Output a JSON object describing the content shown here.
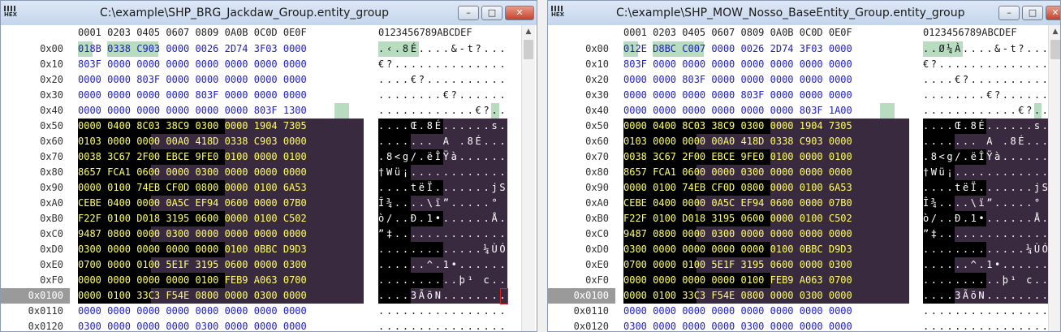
{
  "colors": {
    "title_grad_top": "#dde8f6",
    "hex_default": "#1d1dc9",
    "hex_on_dark": "#ffff66",
    "dark_band": "#000000",
    "purple_band": "#3a2a3f",
    "green_highlight": "#b8dcc0",
    "selected_offset_bg": "#9a9a9a"
  },
  "header": {
    "hex_columns": [
      "0001",
      "0203",
      "0405",
      "0607",
      "0809",
      "0A0B",
      "0C0D",
      "0E0F"
    ],
    "ascii_header": "0123456789ABCDEF"
  },
  "windows": [
    {
      "title": "C:\\example\\SHP_BRG_Jackdaw_Group.entity_group",
      "rows": [
        {
          "offset": "0x00",
          "hex": [
            "018B",
            "0338",
            "C903",
            "0000",
            "0026",
            "2D74",
            "3F03",
            "0000"
          ],
          "ascii": ".‹.8É....&-t?...",
          "style": "light",
          "green": [
            [
              0,
              2
            ],
            [
              4,
              11
            ]
          ]
        },
        {
          "offset": "0x10",
          "hex": [
            "803F",
            "0000",
            "0000",
            "0000",
            "0000",
            "0000",
            "0000",
            "0000"
          ],
          "ascii": "€?..............",
          "style": "light"
        },
        {
          "offset": "0x20",
          "hex": [
            "0000",
            "0000",
            "803F",
            "0000",
            "0000",
            "0000",
            "0000",
            "0000"
          ],
          "ascii": "....€?..........",
          "style": "light"
        },
        {
          "offset": "0x30",
          "hex": [
            "0000",
            "0000",
            "0000",
            "0000",
            "803F",
            "0000",
            "0000",
            "0000"
          ],
          "ascii": "........€?......",
          "style": "light"
        },
        {
          "offset": "0x40",
          "hex": [
            "0000",
            "0000",
            "0000",
            "0000",
            "0000",
            "0000",
            "803F",
            "1300"
          ],
          "ascii": "............€?..",
          "style": "light",
          "green": [
            [
              35,
              37
            ]
          ]
        },
        {
          "offset": "0x50",
          "hex": [
            "0000",
            "0400",
            "8C03",
            "38C9",
            "0300",
            "0000",
            "1904",
            "7305"
          ],
          "ascii": "....Œ.8É......s.",
          "style": "dark"
        },
        {
          "offset": "0x60",
          "hex": [
            "0103",
            "0000",
            "0000",
            "00A0",
            "418D",
            "0338",
            "C903",
            "0000"
          ],
          "ascii": "....... A .8É...",
          "style": "dark"
        },
        {
          "offset": "0x70",
          "hex": [
            "0038",
            "3C67",
            "2F00",
            "EBCE",
            "9FE0",
            "0100",
            "0000",
            "0100"
          ],
          "ascii": ".8<g/.ëÎŸà......",
          "style": "dark"
        },
        {
          "offset": "0x80",
          "hex": [
            "8657",
            "FCA1",
            "0600",
            "0000",
            "0300",
            "0000",
            "0000",
            "0000"
          ],
          "ascii": "†Wü¡............",
          "style": "dark"
        },
        {
          "offset": "0x90",
          "hex": [
            "0000",
            "0100",
            "74EB",
            "CF0D",
            "0800",
            "0000",
            "0100",
            "6A53"
          ],
          "ascii": "....tëÏ.......jS",
          "style": "dark"
        },
        {
          "offset": "0xA0",
          "hex": [
            "CEBE",
            "0400",
            "0000",
            "0A5C",
            "EF94",
            "0600",
            "0000",
            "07B0"
          ],
          "ascii": "Î¾....\\ï”.....°",
          "style": "dark"
        },
        {
          "offset": "0xB0",
          "hex": [
            "F22F",
            "0100",
            "D018",
            "3195",
            "0600",
            "0000",
            "0100",
            "C502"
          ],
          "ascii": "ò/..Ð.1•......Å.",
          "style": "dark"
        },
        {
          "offset": "0xC0",
          "hex": [
            "9487",
            "0800",
            "0000",
            "0300",
            "0000",
            "0000",
            "0000",
            "0000"
          ],
          "ascii": "”‡..............",
          "style": "dark"
        },
        {
          "offset": "0xD0",
          "hex": [
            "0300",
            "0000",
            "0000",
            "0000",
            "0000",
            "0100",
            "0BBC",
            "D9D3"
          ],
          "ascii": ".............¼ÙÓ",
          "style": "dark"
        },
        {
          "offset": "0xE0",
          "hex": [
            "0700",
            "0000",
            "0100",
            "5E1F",
            "3195",
            "0600",
            "0000",
            "0300"
          ],
          "ascii": "......^.1•......",
          "style": "dark"
        },
        {
          "offset": "0xF0",
          "hex": [
            "0000",
            "0000",
            "0000",
            "0000",
            "0100",
            "FEB9",
            "A063",
            "0700"
          ],
          "ascii": "..........þ¹ c..",
          "style": "dark"
        },
        {
          "offset": "0x0100",
          "hex": [
            "0000",
            "0100",
            "33C3",
            "F54E",
            "0800",
            "0000",
            "0300",
            "0000"
          ],
          "ascii": "....3ÃõN........",
          "style": "dark",
          "selected": true,
          "cursor": true
        },
        {
          "offset": "0x0110",
          "hex": [
            "0000",
            "0000",
            "0000",
            "0000",
            "0000",
            "0000",
            "0000",
            "0000"
          ],
          "ascii": "................",
          "style": "light"
        },
        {
          "offset": "0x0120",
          "hex": [
            "0300",
            "0000",
            "0000",
            "0000",
            "0300",
            "0000",
            "0000",
            "0000"
          ],
          "ascii": "................",
          "style": "light"
        }
      ]
    },
    {
      "title": "C:\\example\\SHP_MOW_Nosso_BaseEntity_Group.entity_group",
      "rows": [
        {
          "offset": "0x00",
          "hex": [
            "012E",
            "D8BC",
            "C007",
            "0000",
            "0026",
            "2D74",
            "3F03",
            "0000"
          ],
          "ascii": "..Ø¼À....&-t?...",
          "style": "light",
          "green": [
            [
              0,
              2
            ],
            [
              4,
              11
            ]
          ]
        },
        {
          "offset": "0x10",
          "hex": [
            "803F",
            "0000",
            "0000",
            "0000",
            "0000",
            "0000",
            "0000",
            "0000"
          ],
          "ascii": "€?..............",
          "style": "light"
        },
        {
          "offset": "0x20",
          "hex": [
            "0000",
            "0000",
            "803F",
            "0000",
            "0000",
            "0000",
            "0000",
            "0000"
          ],
          "ascii": "....€?..........",
          "style": "light"
        },
        {
          "offset": "0x30",
          "hex": [
            "0000",
            "0000",
            "0000",
            "0000",
            "803F",
            "0000",
            "0000",
            "0000"
          ],
          "ascii": "........€?......",
          "style": "light"
        },
        {
          "offset": "0x40",
          "hex": [
            "0000",
            "0000",
            "0000",
            "0000",
            "0000",
            "0000",
            "803F",
            "1A00"
          ],
          "ascii": "............€?..",
          "style": "light",
          "green": [
            [
              35,
              37
            ]
          ]
        },
        {
          "offset": "0x50",
          "hex": [
            "0000",
            "0400",
            "8C03",
            "38C9",
            "0300",
            "0000",
            "1904",
            "7305"
          ],
          "ascii": "....Œ.8É......s.",
          "style": "dark"
        },
        {
          "offset": "0x60",
          "hex": [
            "0103",
            "0000",
            "0000",
            "00A0",
            "418D",
            "0338",
            "C903",
            "0000"
          ],
          "ascii": "....... A .8É...",
          "style": "dark"
        },
        {
          "offset": "0x70",
          "hex": [
            "0038",
            "3C67",
            "2F00",
            "EBCE",
            "9FE0",
            "0100",
            "0000",
            "0100"
          ],
          "ascii": ".8<g/.ëÎŸà......",
          "style": "dark"
        },
        {
          "offset": "0x80",
          "hex": [
            "8657",
            "FCA1",
            "0600",
            "0000",
            "0300",
            "0000",
            "0000",
            "0000"
          ],
          "ascii": "†Wü¡............",
          "style": "dark"
        },
        {
          "offset": "0x90",
          "hex": [
            "0000",
            "0100",
            "74EB",
            "CF0D",
            "0800",
            "0000",
            "0100",
            "6A53"
          ],
          "ascii": "....tëÏ.......jS",
          "style": "dark"
        },
        {
          "offset": "0xA0",
          "hex": [
            "CEBE",
            "0400",
            "0000",
            "0A5C",
            "EF94",
            "0600",
            "0000",
            "07B0"
          ],
          "ascii": "Î¾....\\ï”.....°",
          "style": "dark"
        },
        {
          "offset": "0xB0",
          "hex": [
            "F22F",
            "0100",
            "D018",
            "3195",
            "0600",
            "0000",
            "0100",
            "C502"
          ],
          "ascii": "ò/..Ð.1•......Å.",
          "style": "dark"
        },
        {
          "offset": "0xC0",
          "hex": [
            "9487",
            "0800",
            "0000",
            "0300",
            "0000",
            "0000",
            "0000",
            "0000"
          ],
          "ascii": "”‡..............",
          "style": "dark"
        },
        {
          "offset": "0xD0",
          "hex": [
            "0300",
            "0000",
            "0000",
            "0000",
            "0000",
            "0100",
            "0BBC",
            "D9D3"
          ],
          "ascii": ".............¼ÙÓ",
          "style": "dark"
        },
        {
          "offset": "0xE0",
          "hex": [
            "0700",
            "0000",
            "0100",
            "5E1F",
            "3195",
            "0600",
            "0000",
            "0300"
          ],
          "ascii": "......^.1•......",
          "style": "dark"
        },
        {
          "offset": "0xF0",
          "hex": [
            "0000",
            "0000",
            "0000",
            "0000",
            "0100",
            "FEB9",
            "A063",
            "0700"
          ],
          "ascii": "..........þ¹ c..",
          "style": "dark"
        },
        {
          "offset": "0x0100",
          "hex": [
            "0000",
            "0100",
            "33C3",
            "F54E",
            "0800",
            "0000",
            "0300",
            "0000"
          ],
          "ascii": "....3ÃõN........",
          "style": "dark",
          "selected": true
        },
        {
          "offset": "0x0110",
          "hex": [
            "0000",
            "0000",
            "0000",
            "0000",
            "0000",
            "0000",
            "0000",
            "0000"
          ],
          "ascii": "................",
          "style": "light"
        },
        {
          "offset": "0x0120",
          "hex": [
            "0300",
            "0000",
            "0000",
            "0000",
            "0300",
            "0000",
            "0000",
            "0000"
          ],
          "ascii": "................",
          "style": "light"
        }
      ]
    }
  ]
}
